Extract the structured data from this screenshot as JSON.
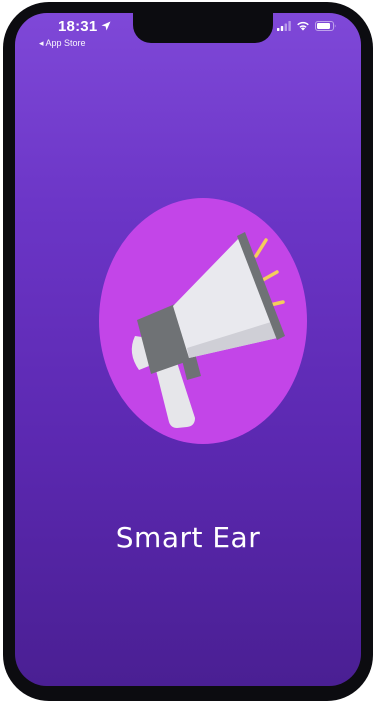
{
  "status_bar": {
    "time": "18:31",
    "back_label": "◂ App Store",
    "icons": [
      "location-arrow-icon",
      "cellular-signal-icon",
      "wifi-icon",
      "battery-icon"
    ]
  },
  "splash": {
    "title": "Smart Ear",
    "logo_icon": "megaphone-icon"
  },
  "colors": {
    "background_top": "#7f48d8",
    "background_bottom": "#4a1f93",
    "logo_circle": "#c345e8",
    "megaphone_body": "#e7e7ec",
    "megaphone_grip": "#6f7275",
    "sound_waves": "#f3cd5c",
    "frame": "#0c0c10"
  }
}
